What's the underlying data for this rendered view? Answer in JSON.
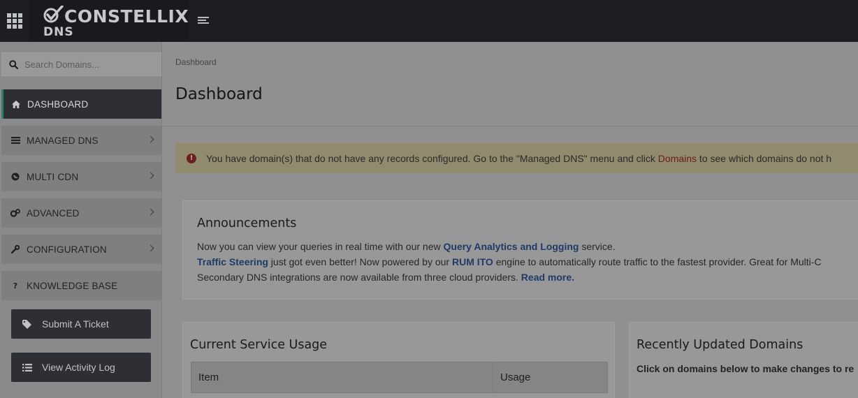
{
  "brand": {
    "name": "CONSTELLIX",
    "product": "DNS"
  },
  "search": {
    "placeholder": "Search Domains..."
  },
  "nav": {
    "items": [
      {
        "label": "DASHBOARD",
        "icon": "home-icon",
        "active": true
      },
      {
        "label": "MANAGED DNS",
        "icon": "list-icon"
      },
      {
        "label": "MULTI CDN",
        "icon": "globe-icon"
      },
      {
        "label": "ADVANCED",
        "icon": "gears-icon"
      },
      {
        "label": "CONFIGURATION",
        "icon": "wrench-icon"
      },
      {
        "label": "KNOWLEDGE BASE",
        "icon": "question-icon"
      }
    ]
  },
  "actions": {
    "ticket_label": "Submit A Ticket",
    "activity_label": "View Activity Log"
  },
  "breadcrumb": "Dashboard",
  "page_title": "Dashboard",
  "alert": {
    "text_before": "You have domain(s) that do not have any records configured. Go to the \"Managed DNS\" menu and click ",
    "link": "Domains",
    "text_after": " to see which domains do not h"
  },
  "announcements": {
    "title": "Announcements",
    "line1_before": "Now you can view your queries in real time with our new ",
    "line1_link": "Query Analytics and Logging",
    "line1_after": " service.",
    "line2_link1": "Traffic Steering",
    "line2_mid": " just got even better! Now powered by our ",
    "line2_link2": "RUM ITO",
    "line2_after": " engine to automatically route traffic to the fastest provider. Great for Multi-C",
    "line3_before": "Secondary DNS integrations are now available from three cloud providers. ",
    "line3_link": "Read more."
  },
  "usage": {
    "title": "Current Service Usage",
    "columns": [
      "Item",
      "Usage"
    ]
  },
  "recent": {
    "title": "Recently Updated Domains",
    "subtitle": "Click on domains below to make changes to re"
  },
  "colors": {
    "topbar": "#1c1e21",
    "active_nav": "#2d2f34",
    "link": "#1f3a66",
    "alert_link": "#6b1c1c"
  }
}
